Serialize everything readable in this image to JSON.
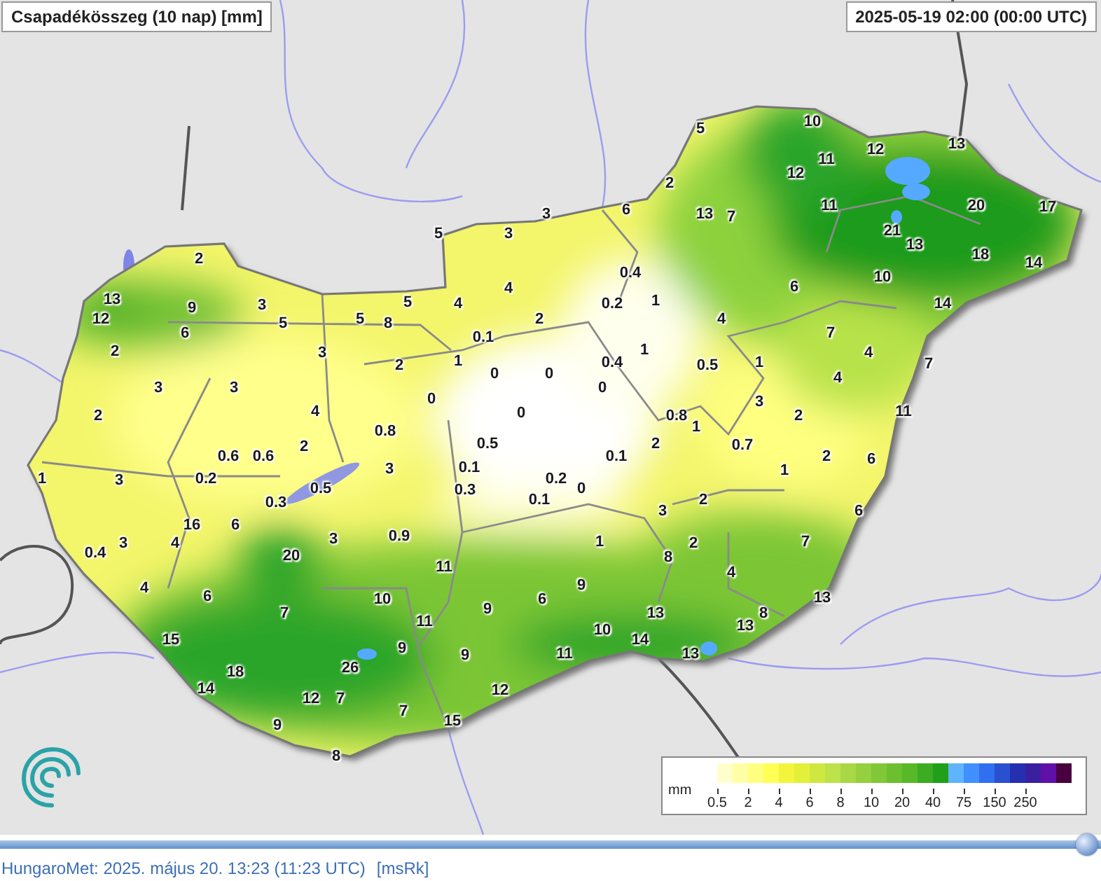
{
  "map": {
    "title": "Csapadékösszeg (10 nap) [mm]",
    "timestamp": "2025-05-19 02:00 (00:00 UTC)",
    "stations": [
      {
        "value": "5"
      },
      {
        "value": "10"
      },
      {
        "value": "12"
      },
      {
        "value": "13"
      },
      {
        "value": "11"
      },
      {
        "value": "12"
      },
      {
        "value": "2"
      },
      {
        "value": "3"
      },
      {
        "value": "6"
      },
      {
        "value": "13"
      },
      {
        "value": "7"
      },
      {
        "value": "11"
      },
      {
        "value": "20"
      },
      {
        "value": "17"
      },
      {
        "value": "5"
      },
      {
        "value": "3"
      },
      {
        "value": "21"
      },
      {
        "value": "13"
      },
      {
        "value": "2"
      },
      {
        "value": "18"
      },
      {
        "value": "14"
      },
      {
        "value": "0.4"
      },
      {
        "value": "10"
      },
      {
        "value": "4"
      },
      {
        "value": "6"
      },
      {
        "value": "13"
      },
      {
        "value": "9"
      },
      {
        "value": "3"
      },
      {
        "value": "5"
      },
      {
        "value": "4"
      },
      {
        "value": "0.2"
      },
      {
        "value": "1"
      },
      {
        "value": "14"
      },
      {
        "value": "12"
      },
      {
        "value": "5"
      },
      {
        "value": "5"
      },
      {
        "value": "8"
      },
      {
        "value": "2"
      },
      {
        "value": "4"
      },
      {
        "value": "6"
      },
      {
        "value": "0.1"
      },
      {
        "value": "7"
      },
      {
        "value": "2"
      },
      {
        "value": "3"
      },
      {
        "value": "1"
      },
      {
        "value": "4"
      },
      {
        "value": "2"
      },
      {
        "value": "1"
      },
      {
        "value": "0.4"
      },
      {
        "value": "0.5"
      },
      {
        "value": "1"
      },
      {
        "value": "7"
      },
      {
        "value": "0"
      },
      {
        "value": "0"
      },
      {
        "value": "4"
      },
      {
        "value": "3"
      },
      {
        "value": "3"
      },
      {
        "value": "0"
      },
      {
        "value": "0"
      },
      {
        "value": "3"
      },
      {
        "value": "2"
      },
      {
        "value": "4"
      },
      {
        "value": "0"
      },
      {
        "value": "0.8"
      },
      {
        "value": "2"
      },
      {
        "value": "11"
      },
      {
        "value": "0.8"
      },
      {
        "value": "1"
      },
      {
        "value": "2"
      },
      {
        "value": "0.5"
      },
      {
        "value": "2"
      },
      {
        "value": "0.7"
      },
      {
        "value": "0.6"
      },
      {
        "value": "0.6"
      },
      {
        "value": "0.1"
      },
      {
        "value": "2"
      },
      {
        "value": "6"
      },
      {
        "value": "3"
      },
      {
        "value": "0.1"
      },
      {
        "value": "1"
      },
      {
        "value": "1"
      },
      {
        "value": "3"
      },
      {
        "value": "0.2"
      },
      {
        "value": "0.2"
      },
      {
        "value": "0.5"
      },
      {
        "value": "0.3"
      },
      {
        "value": "0"
      },
      {
        "value": "0.3"
      },
      {
        "value": "0.1"
      },
      {
        "value": "2"
      },
      {
        "value": "3"
      },
      {
        "value": "6"
      },
      {
        "value": "16"
      },
      {
        "value": "6"
      },
      {
        "value": "3"
      },
      {
        "value": "4"
      },
      {
        "value": "3"
      },
      {
        "value": "0.9"
      },
      {
        "value": "1"
      },
      {
        "value": "2"
      },
      {
        "value": "7"
      },
      {
        "value": "0.4"
      },
      {
        "value": "20"
      },
      {
        "value": "8"
      },
      {
        "value": "11"
      },
      {
        "value": "4"
      },
      {
        "value": "4"
      },
      {
        "value": "9"
      },
      {
        "value": "6"
      },
      {
        "value": "10"
      },
      {
        "value": "6"
      },
      {
        "value": "13"
      },
      {
        "value": "7"
      },
      {
        "value": "9"
      },
      {
        "value": "13"
      },
      {
        "value": "8"
      },
      {
        "value": "11"
      },
      {
        "value": "10"
      },
      {
        "value": "13"
      },
      {
        "value": "15"
      },
      {
        "value": "14"
      },
      {
        "value": "9"
      },
      {
        "value": "9"
      },
      {
        "value": "11"
      },
      {
        "value": "13"
      },
      {
        "value": "18"
      },
      {
        "value": "26"
      },
      {
        "value": "14"
      },
      {
        "value": "12"
      },
      {
        "value": "12"
      },
      {
        "value": "7"
      },
      {
        "value": "7"
      },
      {
        "value": "9"
      },
      {
        "value": "15"
      },
      {
        "value": "8"
      }
    ]
  },
  "legend": {
    "unit": "mm",
    "ticks": [
      "0.5",
      "2",
      "4",
      "6",
      "8",
      "10",
      "20",
      "40",
      "75",
      "150",
      "250"
    ]
  },
  "timeline": {
    "level": 1
  },
  "footer": {
    "text": "HungaroMet: 2025. május 20. 13:23 (11:23 UTC)",
    "link": "[msRk]"
  }
}
